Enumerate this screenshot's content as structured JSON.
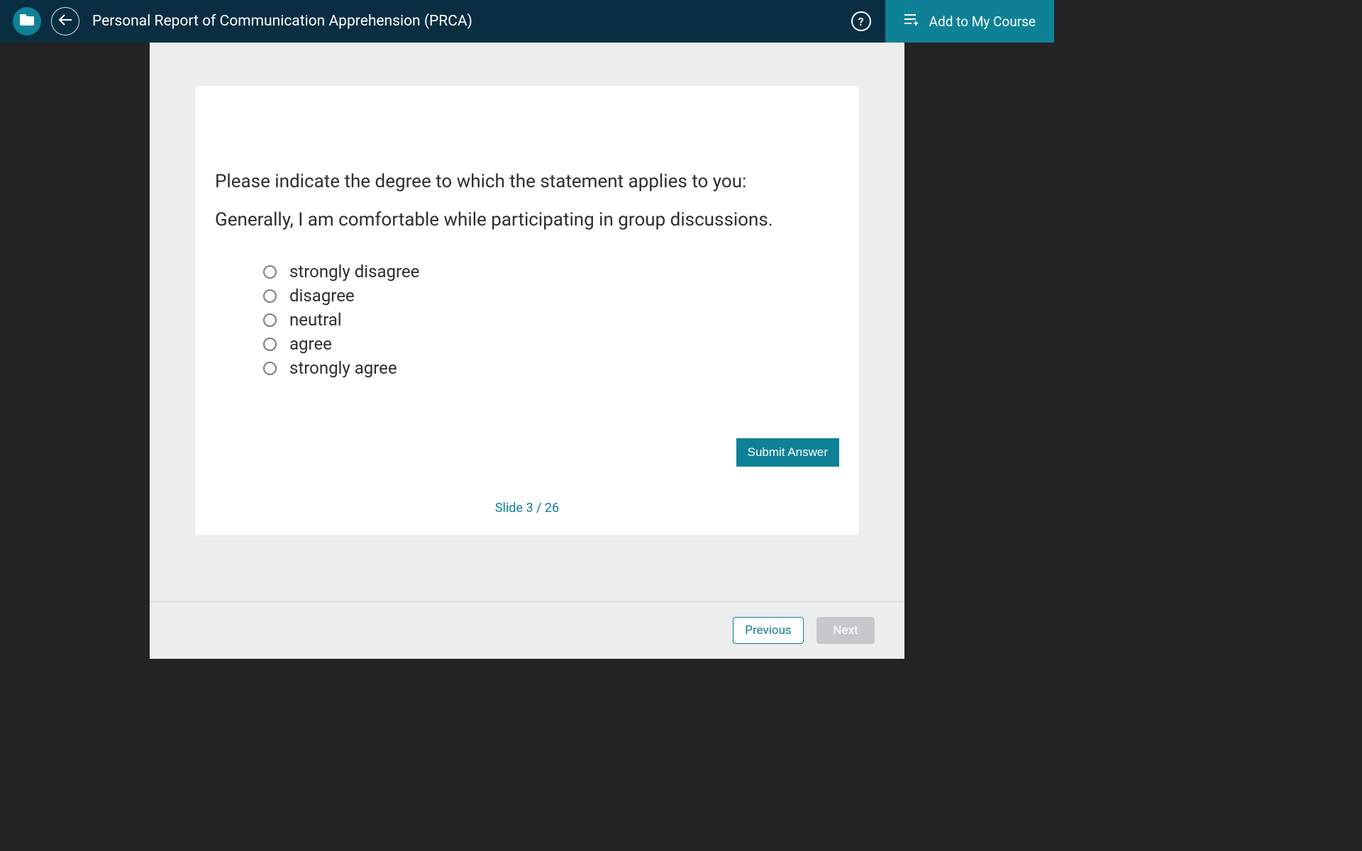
{
  "header": {
    "title": "Personal Report of Communication Apprehension (PRCA)",
    "add_course_label": "Add to My Course",
    "help_label": "?"
  },
  "question": {
    "prompt": "Please indicate the degree to which the statement applies to you:",
    "statement": "Generally, I am comfortable while participating in group discussions.",
    "options": [
      "strongly disagree",
      "disagree",
      "neutral",
      "agree",
      "strongly agree"
    ]
  },
  "buttons": {
    "submit": "Submit Answer",
    "previous": "Previous",
    "next": "Next"
  },
  "slide_counter": "Slide 3 / 26"
}
